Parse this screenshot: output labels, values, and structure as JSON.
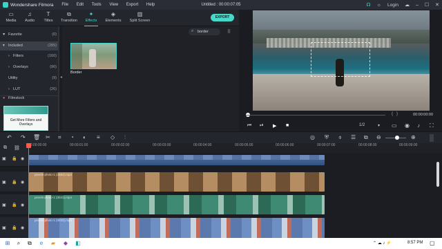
{
  "app": {
    "name": "Wondershare Filmora",
    "menu": [
      "File",
      "Edit",
      "Tools",
      "View",
      "Export",
      "Help"
    ],
    "project_title": "Untitled : 00:00:07:05",
    "login": "Login"
  },
  "toolbar": {
    "tabs": [
      {
        "label": "Media",
        "icon": "folder-icon"
      },
      {
        "label": "Audio",
        "icon": "music-note-icon"
      },
      {
        "label": "Titles",
        "icon": "text-T-icon"
      },
      {
        "label": "Transition",
        "icon": "transition-icon"
      },
      {
        "label": "Effects",
        "icon": "effects-icon",
        "active": true
      },
      {
        "label": "Elements",
        "icon": "elements-icon"
      },
      {
        "label": "Split Screen",
        "icon": "split-screen-icon"
      }
    ],
    "export_label": "EXPORT"
  },
  "sidebar": {
    "items": [
      {
        "label": "Favorite",
        "count": "(0)",
        "icon": "heart-icon"
      },
      {
        "label": "Included",
        "count": "(285)",
        "icon": "chevron-down-icon",
        "selected": true
      },
      {
        "label": "Filters",
        "count": "(160)",
        "sub": true
      },
      {
        "label": "Overlays",
        "count": "(90)",
        "sub": true
      },
      {
        "label": "Utility",
        "count": "(9)"
      },
      {
        "label": "LUT",
        "count": "(26)",
        "sub": true
      },
      {
        "label": "Filmstock",
        "count": "",
        "icon": "filmstock-icon"
      }
    ],
    "promo": "Get More Filters and Overlays"
  },
  "search": {
    "value": "border"
  },
  "effects": [
    {
      "label": "Border"
    }
  ],
  "preview": {
    "timecode": "00:00:00:00",
    "ratio": "1/2",
    "accent": "#45d6c9"
  },
  "timeline": {
    "ruler": [
      "00:00:00:00",
      "00:00:01:00",
      "00:00:02:00",
      "00:00:03:00",
      "00:00:04:00",
      "00:00:05:00",
      "00:00:06:00",
      "00:00:07:00",
      "00:00:08:00",
      "00:00:09:00"
    ],
    "tracks": [
      {
        "label": "",
        "clip": "",
        "color": "#3b5e8f"
      },
      {
        "label": "",
        "clip": "pexels-photo-1 (2584).mp4",
        "color": "#7b5a3f"
      },
      {
        "label": "",
        "clip": "pexels-photo-1 (3041).mp4",
        "color": "#2f7a68"
      },
      {
        "label": "",
        "clip": "pexels-photo-1 (3033).mp4",
        "color": "#4c6ea3"
      }
    ]
  },
  "taskbar": {
    "time": "8:57 PM"
  }
}
